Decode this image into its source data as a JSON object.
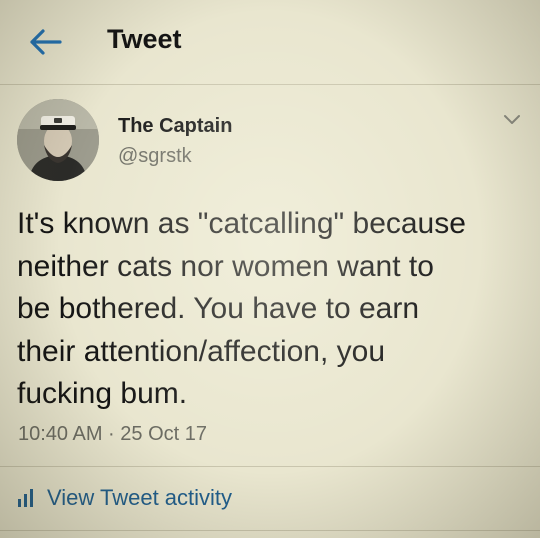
{
  "header": {
    "title": "Tweet"
  },
  "author": {
    "name": "The Captain",
    "handle": "@sgrstk"
  },
  "tweet": {
    "text": "It's known as \"catcalling\" because\nneither cats nor women want to\nbe bothered. You have to earn\ntheir attention/affection, you\nfucking bum.",
    "timestamp": "10:40 AM · 25 Oct 17"
  },
  "actions": {
    "view_activity_label": "View Tweet activity"
  },
  "colors": {
    "accent": "#1f5d8c",
    "background": "#e9e6cf",
    "text": "#141414",
    "muted": "#6b6b62"
  }
}
